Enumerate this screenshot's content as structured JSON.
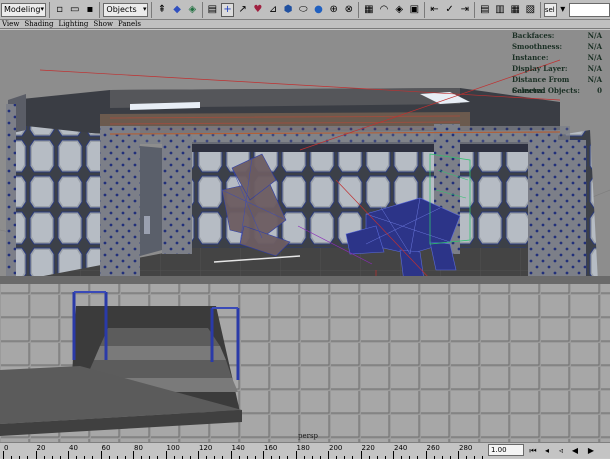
{
  "toolbar": {
    "menu_set": "Modeling",
    "selection_mask": "Objects",
    "rename_field": "sel",
    "rename_value": ""
  },
  "panel_menu": [
    "View",
    "Shading",
    "Lighting",
    "Show",
    "Panels"
  ],
  "viewport": {
    "camera": "persp",
    "hud": [
      {
        "label": "Backfaces:",
        "value": "N/A"
      },
      {
        "label": "Smoothness:",
        "value": "N/A"
      },
      {
        "label": "Instance:",
        "value": "N/A"
      },
      {
        "label": "Display Layer:",
        "value": "N/A"
      },
      {
        "label": "Distance From Camera:",
        "value": "N/A"
      },
      {
        "label": "Selected Objects:",
        "value": "0"
      }
    ]
  },
  "timeline": {
    "ticks": [
      "0",
      "20",
      "40",
      "60",
      "80",
      "100",
      "120",
      "140",
      "160",
      "180",
      "200",
      "220",
      "240",
      "260",
      "280"
    ],
    "current_frame": "1.00"
  },
  "icons": {
    "playback": [
      "go-to-start-icon",
      "step-back-icon",
      "step-back-key-icon",
      "play-backwards-icon",
      "play-forwards-icon"
    ]
  }
}
